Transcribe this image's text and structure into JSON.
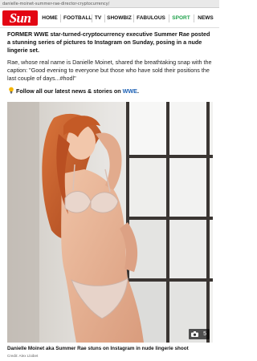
{
  "browser": {
    "url": "danielle-moinet-summer-rae-director-cryptocurrency/"
  },
  "nav": {
    "logo": "Sun",
    "items": [
      "HOME",
      "FOOTBALL",
      "TV",
      "SHOWBIZ",
      "FABULOUS",
      "SPORT",
      "NEWS"
    ],
    "active_item": "SPORT",
    "colors": {
      "brand": "#e30613",
      "active": "#1fa14b"
    }
  },
  "article": {
    "lede": "FORMER WWE star-turned-cryptocurrency executive Summer Rae posted a stunning series of pictures to Instagram on Sunday, posing in a nude lingerie set.",
    "body": "Rae, whose real name is Danielle Moinet, shared the breathtaking snap with the caption: \"Good evening to everyone but those who have sold their positions the last couple of days...#hodl\"",
    "follow_text": "Follow all our latest news & stories on ",
    "follow_link": "WWE",
    "follow_tail": ".",
    "follow_icon": "lightbulb-icon"
  },
  "photo": {
    "gallery_count": "5",
    "counter_icon": "camera-icon",
    "caption": "Danielle Moinet aka Summer Rae stuns on Instagram in nude lingerie shoot",
    "credit": "Credit: Alex Lloibet"
  }
}
